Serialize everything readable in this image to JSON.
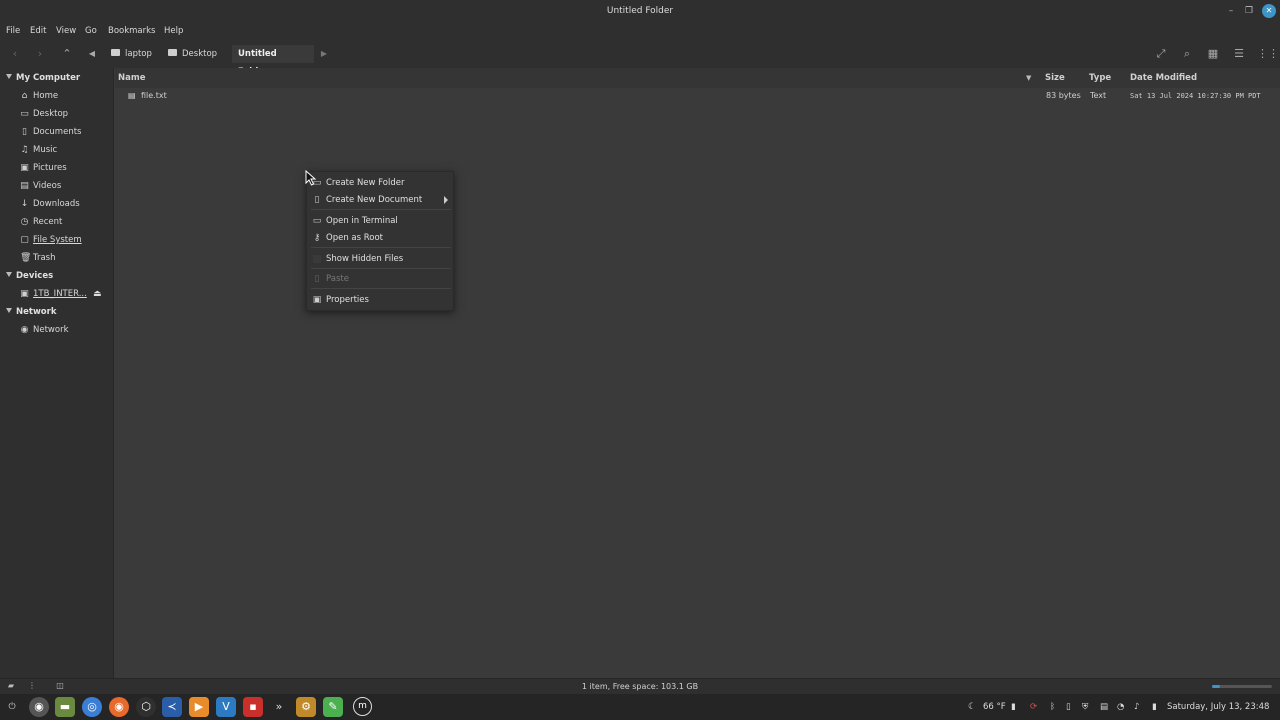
{
  "window": {
    "title": "Untitled Folder"
  },
  "menubar": {
    "file": "File",
    "edit": "Edit",
    "view": "View",
    "go": "Go",
    "bookmarks": "Bookmarks",
    "help": "Help"
  },
  "breadcrumb": {
    "home": "laptop",
    "desktop": "Desktop",
    "current": "Untitled Folder"
  },
  "sidebar": {
    "my_computer": "My Computer",
    "items": [
      "Home",
      "Desktop",
      "Documents",
      "Music",
      "Pictures",
      "Videos",
      "Downloads",
      "Recent",
      "File System",
      "Trash"
    ],
    "devices": "Devices",
    "device_item": "1TB_INTER...",
    "network": "Network",
    "network_item": "Network"
  },
  "columns": {
    "name": "Name",
    "size": "Size",
    "type": "Type",
    "date": "Date Modified"
  },
  "files": [
    {
      "name": "file.txt",
      "size": "83 bytes",
      "type": "Text",
      "date": "Sat 13 Jul 2024 10:27:30 PM PDT"
    }
  ],
  "context_menu": {
    "new_folder": "Create New Folder",
    "new_document": "Create New Document",
    "open_terminal": "Open in Terminal",
    "open_root": "Open as Root",
    "show_hidden": "Show Hidden Files",
    "paste": "Paste",
    "properties": "Properties"
  },
  "status": {
    "text": "1 item, Free space: 103.1 GB"
  },
  "taskbar": {
    "temperature": "66 °F",
    "clock": "Saturday, July 13, 23:48"
  },
  "colors": {
    "accent": "#3d95c8",
    "background": "#3a3a3a",
    "sidebar": "#2f2f2f"
  }
}
